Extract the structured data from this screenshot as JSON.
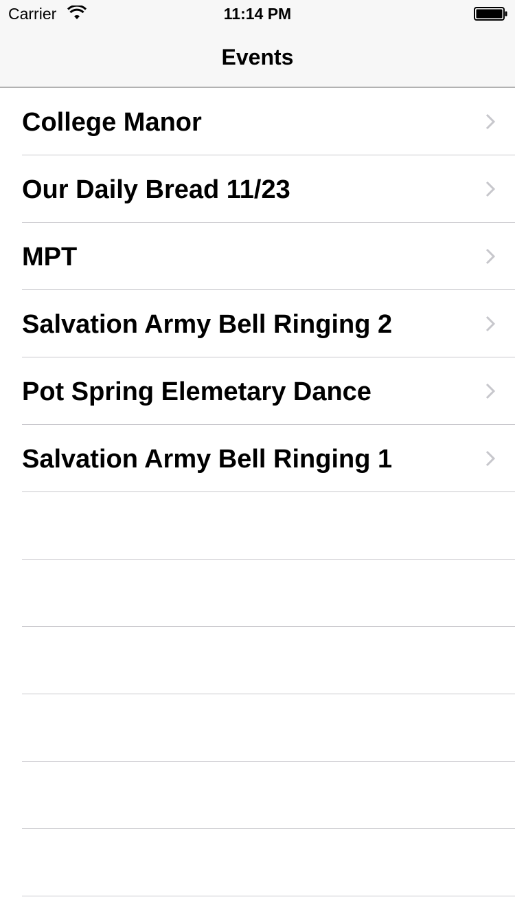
{
  "status_bar": {
    "carrier": "Carrier",
    "time": "11:14 PM"
  },
  "nav_bar": {
    "title": "Events"
  },
  "events": [
    {
      "label": "College Manor"
    },
    {
      "label": "Our Daily Bread 11/23"
    },
    {
      "label": "MPT"
    },
    {
      "label": "Salvation Army Bell Ringing 2"
    },
    {
      "label": "Pot Spring Elemetary Dance"
    },
    {
      "label": "Salvation Army Bell Ringing 1"
    }
  ],
  "icons": {
    "wifi": "wifi-icon",
    "battery": "battery-icon",
    "chevron": "chevron-right-icon"
  },
  "colors": {
    "bar_background": "#f7f7f7",
    "separator": "#c8c7cc",
    "chevron": "#c7c7cc"
  }
}
